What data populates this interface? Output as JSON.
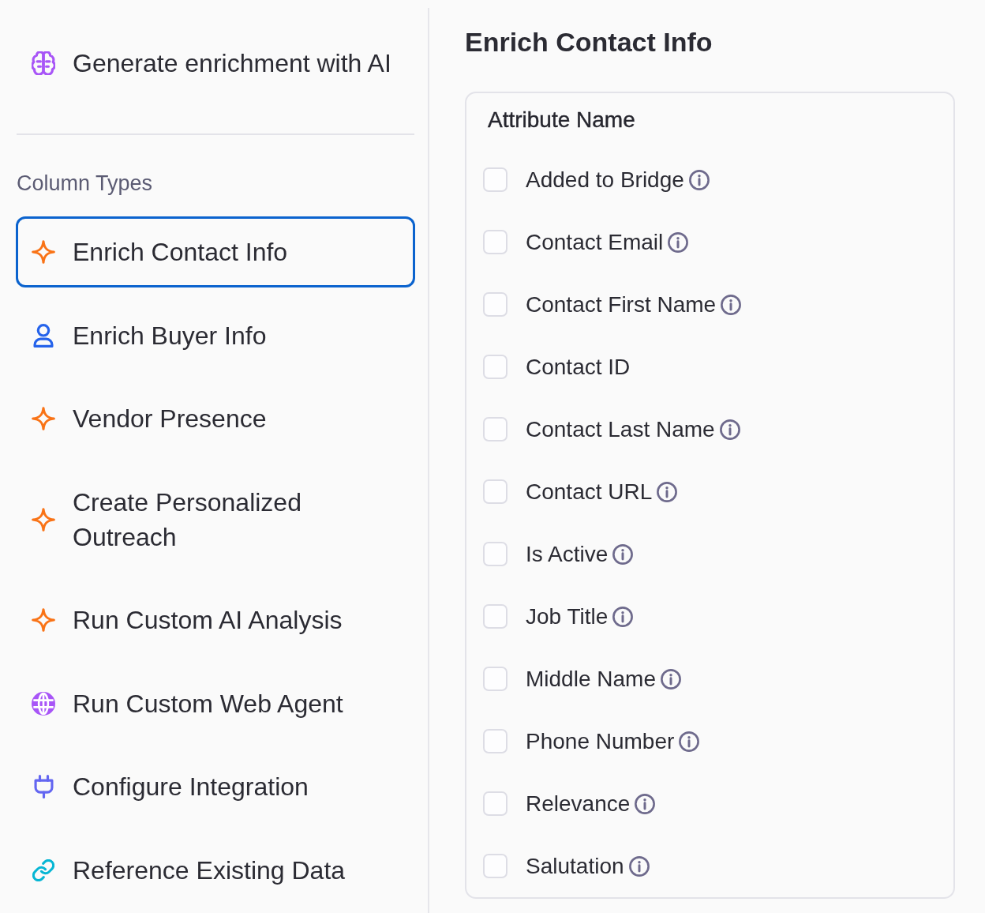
{
  "sidebar": {
    "generate_button": {
      "label": "Generate enrichment with AI"
    },
    "section_title": "Column Types",
    "items": [
      {
        "label": "Enrich Contact Info",
        "kind": "sparkle",
        "selected": true
      },
      {
        "label": "Enrich Buyer Info",
        "kind": "user",
        "selected": false
      },
      {
        "label": "Vendor Presence",
        "kind": "sparkle",
        "selected": false
      },
      {
        "label": "Create Personalized Outreach",
        "kind": "sparkle",
        "selected": false
      },
      {
        "label": "Run Custom AI Analysis",
        "kind": "sparkle",
        "selected": false
      },
      {
        "label": "Run Custom Web Agent",
        "kind": "globe",
        "selected": false
      },
      {
        "label": "Configure Integration",
        "kind": "plug",
        "selected": false
      },
      {
        "label": "Reference Existing Data",
        "kind": "link",
        "selected": false
      }
    ]
  },
  "main": {
    "title": "Enrich Contact Info",
    "table": {
      "columns": [
        "Attribute Name"
      ],
      "rows": [
        {
          "label": "Added to Bridge",
          "checked": false,
          "info": true
        },
        {
          "label": "Contact Email",
          "checked": false,
          "info": true
        },
        {
          "label": "Contact First Name",
          "checked": false,
          "info": true
        },
        {
          "label": "Contact ID",
          "checked": false,
          "info": false
        },
        {
          "label": "Contact Last Name",
          "checked": false,
          "info": true
        },
        {
          "label": "Contact URL",
          "checked": false,
          "info": true
        },
        {
          "label": "Is Active",
          "checked": false,
          "info": true
        },
        {
          "label": "Job Title",
          "checked": false,
          "info": true
        },
        {
          "label": "Middle Name",
          "checked": false,
          "info": true
        },
        {
          "label": "Phone Number",
          "checked": false,
          "info": true
        },
        {
          "label": "Relevance",
          "checked": false,
          "info": true
        },
        {
          "label": "Salutation",
          "checked": false,
          "info": true
        }
      ]
    }
  }
}
